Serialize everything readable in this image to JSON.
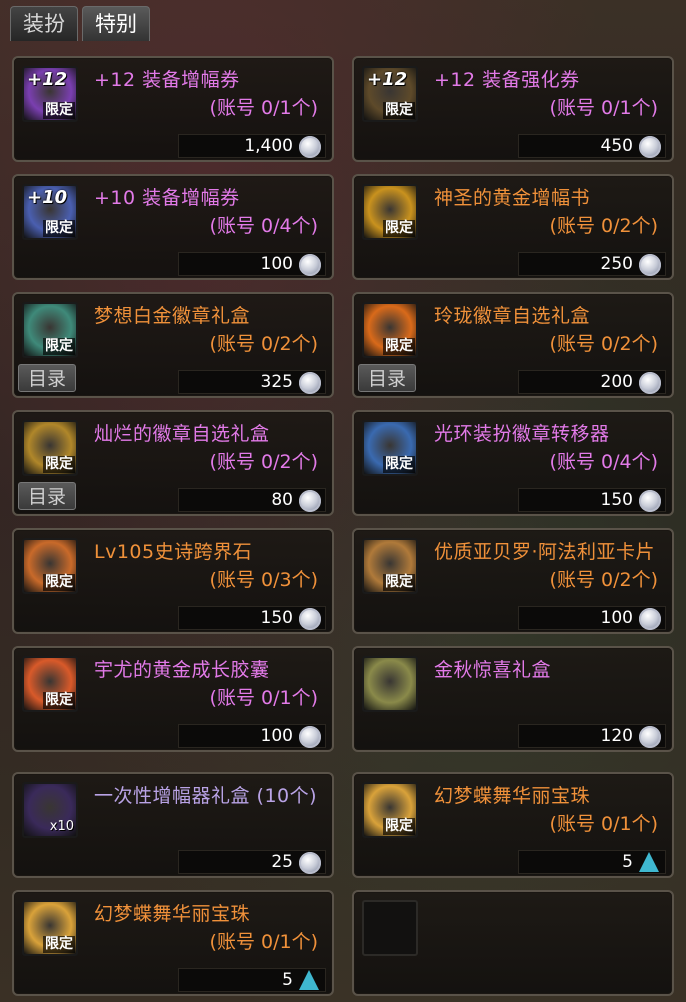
{
  "tabs": [
    "装扮",
    "特别"
  ],
  "items": [
    {
      "name": "+12 装备增幅券",
      "sub": "(账号 0/1个)",
      "price": "1,400",
      "color": "pink",
      "badge": "+12",
      "limit": "限定",
      "currency": "coin",
      "catalog": ""
    },
    {
      "name": "+12 装备强化券",
      "sub": "(账号 0/1个)",
      "price": "450",
      "color": "pink",
      "badge": "+12",
      "limit": "限定",
      "currency": "coin",
      "catalog": ""
    },
    {
      "name": "+10 装备增幅券",
      "sub": "(账号 0/4个)",
      "price": "100",
      "color": "pink",
      "badge": "+10",
      "limit": "限定",
      "currency": "coin",
      "catalog": ""
    },
    {
      "name": "神圣的黄金增幅书",
      "sub": "(账号 0/2个)",
      "price": "250",
      "color": "orange",
      "badge": "",
      "limit": "限定",
      "currency": "coin",
      "catalog": ""
    },
    {
      "name": "梦想白金徽章礼盒",
      "sub": "(账号 0/2个)",
      "price": "325",
      "color": "orange",
      "badge": "",
      "limit": "限定",
      "currency": "coin",
      "catalog": "目录"
    },
    {
      "name": "玲珑徽章自选礼盒",
      "sub": "(账号 0/2个)",
      "price": "200",
      "color": "orange",
      "badge": "",
      "limit": "限定",
      "currency": "coin",
      "catalog": "目录"
    },
    {
      "name": "灿烂的徽章自选礼盒",
      "sub": "(账号 0/2个)",
      "price": "80",
      "color": "pink",
      "badge": "",
      "limit": "限定",
      "currency": "coin",
      "catalog": "目录"
    },
    {
      "name": "光环装扮徽章转移器",
      "sub": "(账号 0/4个)",
      "price": "150",
      "color": "pink",
      "badge": "",
      "limit": "限定",
      "currency": "coin",
      "catalog": ""
    },
    {
      "name": "Lv105史诗跨界石",
      "sub": "(账号 0/3个)",
      "price": "150",
      "color": "orange",
      "badge": "",
      "limit": "限定",
      "currency": "coin",
      "catalog": ""
    },
    {
      "name": "优质亚贝罗·阿法利亚卡片",
      "sub": "(账号 0/2个)",
      "price": "100",
      "color": "orange",
      "badge": "",
      "limit": "限定",
      "currency": "coin",
      "catalog": ""
    },
    {
      "name": "宇尤的黄金成长胶囊",
      "sub": "(账号 0/1个)",
      "price": "100",
      "color": "pink",
      "badge": "",
      "limit": "限定",
      "currency": "coin",
      "catalog": ""
    },
    {
      "name": "金秋惊喜礼盒",
      "sub": "",
      "price": "120",
      "color": "pink",
      "badge": "",
      "limit": "",
      "currency": "coin",
      "catalog": ""
    },
    {
      "name": "一次性增幅器礼盒 (10个)",
      "sub": "",
      "price": "25",
      "color": "lav",
      "badge": "",
      "limit": "",
      "qty": "x10",
      "currency": "coin",
      "catalog": ""
    },
    {
      "name": "幻梦蝶舞华丽宝珠",
      "sub": "(账号 0/1个)",
      "price": "5",
      "color": "orange",
      "badge": "",
      "limit": "限定",
      "currency": "gem",
      "catalog": ""
    },
    {
      "name": "幻梦蝶舞华丽宝珠",
      "sub": "(账号 0/1个)",
      "price": "5",
      "color": "orange",
      "badge": "",
      "limit": "限定",
      "currency": "gem",
      "catalog": ""
    }
  ],
  "icon_colors": [
    "#7a3fb0",
    "#5e4a2a",
    "#4a5fb0",
    "#c9921e",
    "#3f8a7a",
    "#d96a1a",
    "#b0872a",
    "#3a6ab0",
    "#c96a2a",
    "#b07a3a",
    "#d95a2a",
    "#8a8a4a",
    "#3a2a5a",
    "#d9a23a",
    "#d9a23a"
  ]
}
